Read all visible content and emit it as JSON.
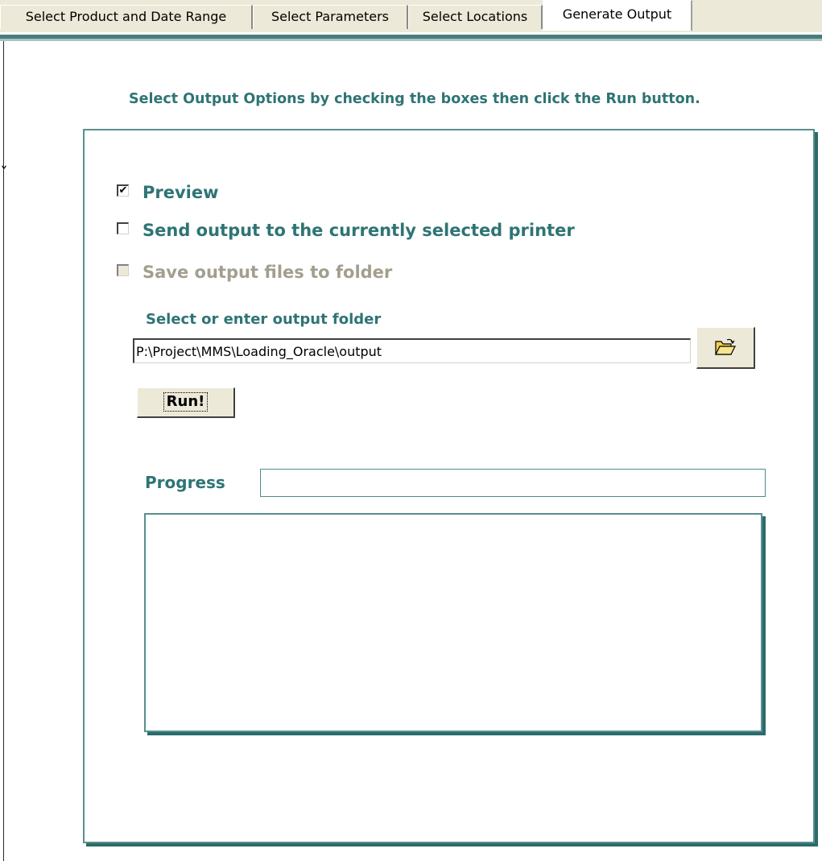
{
  "tabs": [
    {
      "label": "Select Product and Date Range",
      "active": false
    },
    {
      "label": "Select Parameters",
      "active": false
    },
    {
      "label": "Select Locations",
      "active": false
    },
    {
      "label": "Generate Output",
      "active": true
    }
  ],
  "instruction": "Select Output Options by checking the boxes then click the Run button.",
  "options": {
    "preview": {
      "label": "Preview",
      "checked": true,
      "enabled": true
    },
    "printer": {
      "label": "Send output to the currently selected printer",
      "checked": false,
      "enabled": true
    },
    "save": {
      "label": "Save output files to folder",
      "checked": false,
      "enabled": false
    }
  },
  "folder": {
    "label": "Select or enter output folder",
    "value": "P:\\Project\\MMS\\Loading_Oracle\\output",
    "browse_icon": "open-folder-icon"
  },
  "run_button": {
    "label": "Run!"
  },
  "progress": {
    "label": "Progress",
    "value": 0
  },
  "log": {
    "text": ""
  },
  "colors": {
    "accent": "#2f7474",
    "tab_face": "#ece9d8",
    "disabled_text": "#a29f8f"
  }
}
